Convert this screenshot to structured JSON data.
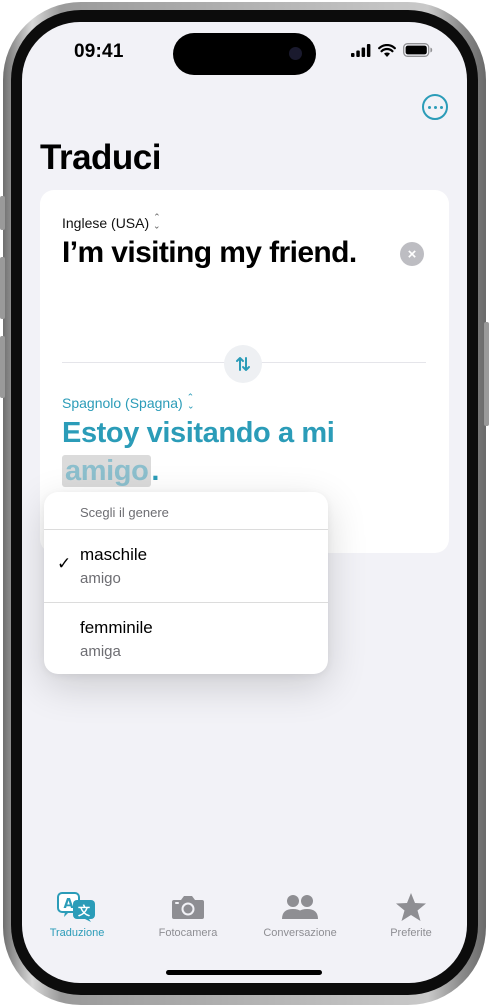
{
  "status_bar": {
    "time": "09:41"
  },
  "header": {
    "title": "Traduci",
    "more_icon": "ellipsis-circle-icon"
  },
  "source": {
    "language": "Inglese (USA)",
    "text": "I’m visiting my friend."
  },
  "target": {
    "language": "Spagnolo (Spagna)",
    "text_before": "Estoy visitando a mi",
    "highlighted_word": "amigo",
    "text_after": "."
  },
  "gender_menu": {
    "title": "Scegli il genere",
    "options": [
      {
        "label": "maschile",
        "value": "amigo",
        "checked": true
      },
      {
        "label": "femminile",
        "value": "amiga",
        "checked": false
      }
    ]
  },
  "tab_bar": {
    "tabs": [
      {
        "label": "Traduzione",
        "icon": "translate-icon",
        "active": true
      },
      {
        "label": "Fotocamera",
        "icon": "camera-icon",
        "active": false
      },
      {
        "label": "Conversazione",
        "icon": "people-icon",
        "active": false
      },
      {
        "label": "Preferite",
        "icon": "star-icon",
        "active": false
      }
    ]
  },
  "colors": {
    "accent": "#2b9cb8",
    "background": "#f2f2f7"
  }
}
